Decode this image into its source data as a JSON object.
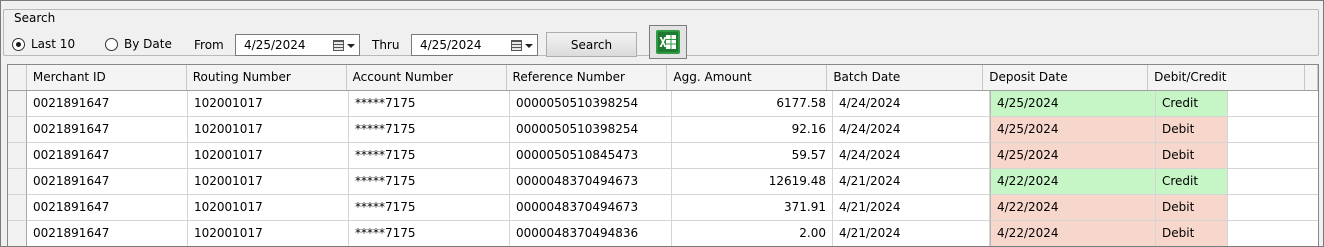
{
  "search": {
    "legend": "Search",
    "radio_last10": "Last 10",
    "radio_bydate": "By Date",
    "from_label": "From",
    "from_value": "4/25/2024",
    "thru_label": "Thru",
    "thru_value": "4/25/2024",
    "search_button": "Search",
    "selected_mode": "Last 10"
  },
  "grid": {
    "columns": [
      "Merchant ID",
      "Routing Number",
      "Account Number",
      "Reference Number",
      "Agg. Amount",
      "Batch Date",
      "Deposit Date",
      "Debit/Credit"
    ],
    "rows": [
      {
        "merchant": "0021891647",
        "routing": "102001017",
        "account": "*****7175",
        "ref": "0000050510398254",
        "amount": "6177.58",
        "batch": "4/24/2024",
        "deposit": "4/25/2024",
        "type": "Credit"
      },
      {
        "merchant": "0021891647",
        "routing": "102001017",
        "account": "*****7175",
        "ref": "0000050510398254",
        "amount": "92.16",
        "batch": "4/24/2024",
        "deposit": "4/25/2024",
        "type": "Debit"
      },
      {
        "merchant": "0021891647",
        "routing": "102001017",
        "account": "*****7175",
        "ref": "0000050510845473",
        "amount": "59.57",
        "batch": "4/24/2024",
        "deposit": "4/25/2024",
        "type": "Debit"
      },
      {
        "merchant": "0021891647",
        "routing": "102001017",
        "account": "*****7175",
        "ref": "0000048370494673",
        "amount": "12619.48",
        "batch": "4/21/2024",
        "deposit": "4/22/2024",
        "type": "Credit"
      },
      {
        "merchant": "0021891647",
        "routing": "102001017",
        "account": "*****7175",
        "ref": "0000048370494673",
        "amount": "371.91",
        "batch": "4/21/2024",
        "deposit": "4/22/2024",
        "type": "Debit"
      },
      {
        "merchant": "0021891647",
        "routing": "102001017",
        "account": "*****7175",
        "ref": "0000048370494836",
        "amount": "2.00",
        "batch": "4/21/2024",
        "deposit": "4/22/2024",
        "type": "Debit"
      }
    ]
  },
  "colors": {
    "credit_bg": "#c6f5c6",
    "debit_bg": "#f7d6cc",
    "excel_green": "#1e7a33"
  },
  "icons": {
    "excel_export": "excel-icon",
    "calendar": "calendar-icon"
  }
}
